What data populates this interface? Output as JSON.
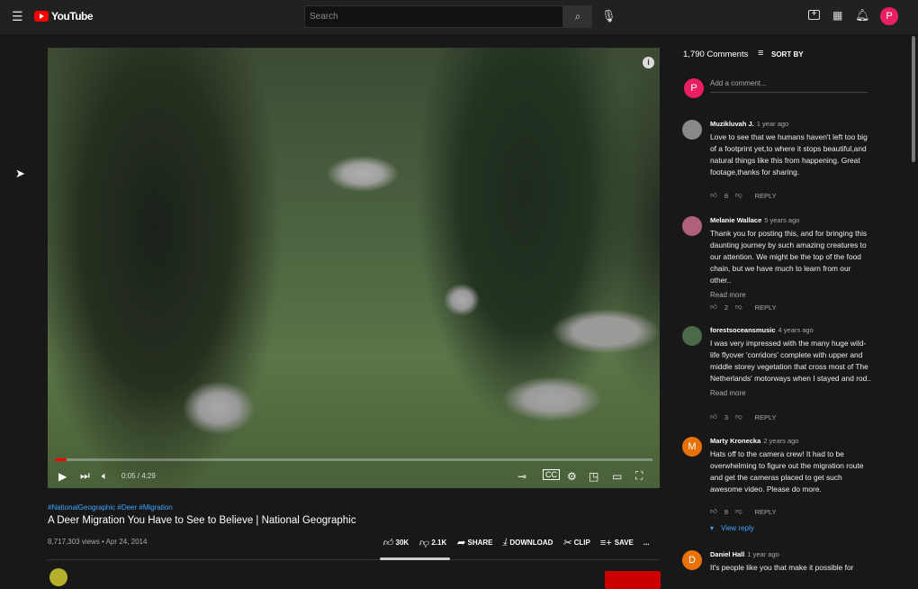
{
  "header": {
    "logo_text": "YouTube",
    "search_placeholder": "Search",
    "avatar_letter": "P"
  },
  "video": {
    "time": "0:05 / 4:29",
    "progress_percent": 2,
    "hashtags": "#NationalGeographic #Deer #Migration",
    "title": "A Deer Migration You Have to See to Believe | National Geographic",
    "views_date": "8,717,303 views • Apr 24, 2014",
    "likes": "30K",
    "dislikes": "2.1K",
    "share": "SHARE",
    "download": "DOWNLOAD",
    "clip": "CLIP",
    "save": "SAVE",
    "more": "..."
  },
  "comments": {
    "count": "1,790 Comments",
    "sort": "SORT BY",
    "add_placeholder": "Add a comment...",
    "user_letter": "P",
    "items": [
      {
        "author": "Muzikluvah J.",
        "age": "1 year ago",
        "text": "Love to see that we humans haven't left too big of a footprint yet,to where it stops beautiful,and natural things like this from happening. Great footage,thanks for sharing.",
        "likes": "8",
        "reply": "REPLY",
        "avatar_color": "#888888",
        "letter": ""
      },
      {
        "author": "Melanie Wallace",
        "age": "5 years ago",
        "text": "Thank you for posting this, and for bringing this daunting journey by such amazing creatures to our attention. We might be the top of the food chain, but we have much to learn from our other..",
        "read_more": "Read more",
        "likes": "2",
        "reply": "REPLY",
        "avatar_color": "#b0607a",
        "letter": ""
      },
      {
        "author": "forestsoceansmusic",
        "age": "4 years ago",
        "text": "I was very impressed with the many huge wild-life flyover 'corridors' complete with upper and middle storey vegetation that cross most of The Netherlands' motorways when I stayed and rod..",
        "read_more": "Read more",
        "likes": "3",
        "reply": "REPLY",
        "avatar_color": "#4a6a48",
        "letter": ""
      },
      {
        "author": "Marty Kronecka",
        "age": "2 years ago",
        "text": "Hats off to the camera crew! It had to be overwhelming to figure out the migration route and get the cameras placed to get such awesome video. Please do more.",
        "likes": "8",
        "reply": "REPLY",
        "view_reply": "View reply",
        "avatar_color": "#e8710a",
        "letter": "M"
      },
      {
        "author": "Daniel Hall",
        "age": "1 year ago",
        "text": "It's people like you that make it possible for",
        "avatar_color": "#e8710a",
        "letter": "D"
      }
    ]
  }
}
